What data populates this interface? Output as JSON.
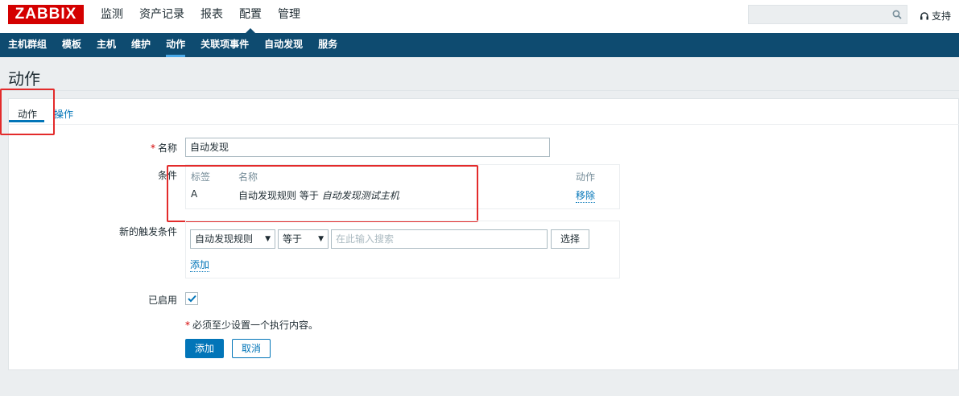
{
  "header": {
    "logo": "ZABBIX",
    "main_nav": [
      "监测",
      "资产记录",
      "报表",
      "配置",
      "管理"
    ],
    "active_main": "配置",
    "search_placeholder": "",
    "support": "支持"
  },
  "sub_nav": {
    "items": [
      "主机群组",
      "模板",
      "主机",
      "维护",
      "动作",
      "关联项事件",
      "自动发现",
      "服务"
    ],
    "active": "动作"
  },
  "page": {
    "title": "动作"
  },
  "tabs": {
    "action": "动作",
    "operations": "操作"
  },
  "form": {
    "name_label": "名称",
    "name_value": "自动发现",
    "conditions_label": "条件",
    "conditions_headers": {
      "label": "标签",
      "name": "名称",
      "action": "动作"
    },
    "conditions": [
      {
        "label": "A",
        "name_prefix": "自动发现规则 等于 ",
        "name_value": "自动发现测试主机",
        "action": "移除"
      }
    ],
    "new_condition_label": "新的触发条件",
    "new_condition_type": "自动发现规则",
    "new_condition_operator": "等于",
    "new_condition_search_placeholder": "在此输入搜索",
    "select_button": "选择",
    "add_link": "添加",
    "enabled_label": "已启用",
    "enabled": true,
    "note": "必须至少设置一个执行内容。",
    "submit": "添加",
    "cancel": "取消"
  },
  "colors": {
    "brand_red": "#d40000",
    "nav_blue": "#0e4b70",
    "link_blue": "#0275b8",
    "highlight_red": "#e32b2b"
  }
}
